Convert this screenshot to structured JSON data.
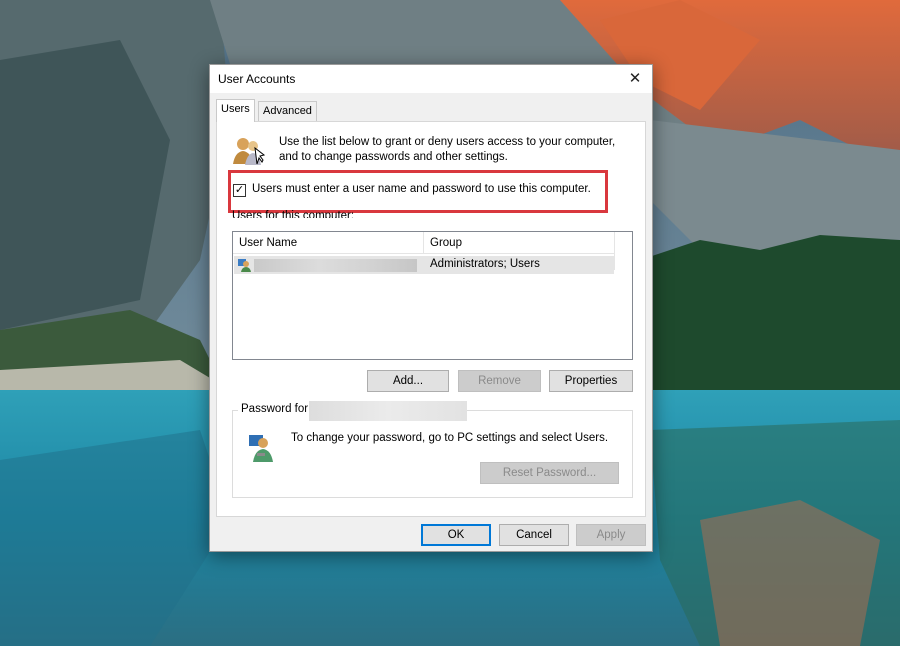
{
  "dialog": {
    "title": "User Accounts",
    "close_glyph": "✕"
  },
  "tabs": [
    {
      "label": "Users",
      "active": true
    },
    {
      "label": "Advanced",
      "active": false
    }
  ],
  "users_tab": {
    "intro_icon": "users-key-icon",
    "intro_text": "Use the list below to grant or deny users access to your computer, and to change passwords and other settings.",
    "require_login_checkbox": {
      "label": "Users must enter a user name and password to use this computer.",
      "checked": true,
      "check_glyph": "✓"
    },
    "highlight_color": "#d9383e",
    "users_list_label": "Users for this computer:",
    "list": {
      "columns": [
        "User Name",
        "Group"
      ],
      "rows": [
        {
          "user_icon": "user-icon",
          "user_name_redacted": true,
          "group": "Administrators; Users"
        }
      ]
    },
    "buttons": {
      "add": "Add...",
      "remove": "Remove",
      "properties": "Properties"
    },
    "password_group": {
      "title": "Password for",
      "account_redacted": true,
      "icon": "user-key-icon",
      "text": "To change your password, go to PC settings and select Users.",
      "reset_button": "Reset Password..."
    }
  },
  "footer": {
    "ok": "OK",
    "cancel": "Cancel",
    "apply": "Apply"
  },
  "colors": {
    "accent": "#0078d7",
    "dialog_bg": "#f0f0f0",
    "panel_bg": "#ffffff"
  }
}
